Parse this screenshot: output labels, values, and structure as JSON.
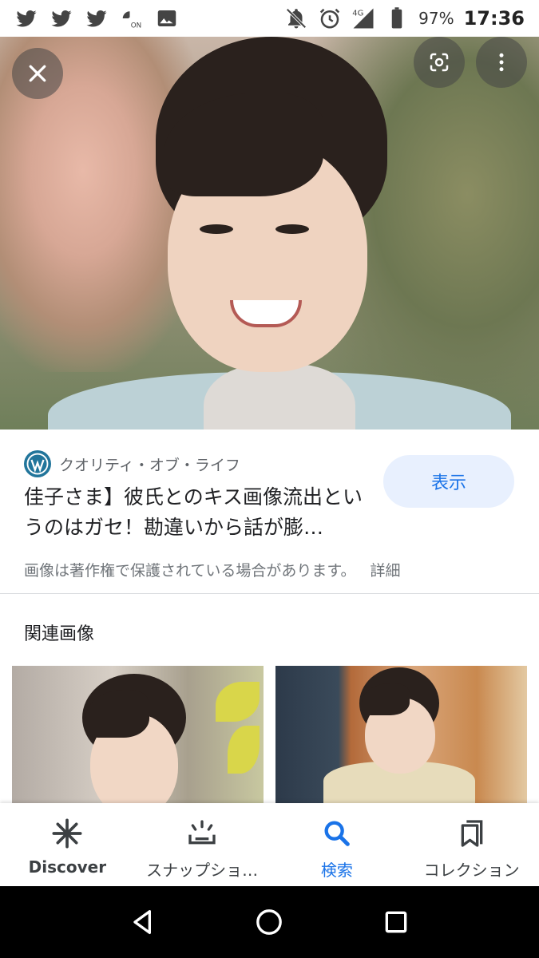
{
  "status_bar": {
    "icons": [
      "twitter-icon",
      "twitter-icon",
      "twitter-icon",
      "nfc-on-icon",
      "image-icon",
      "notifications-off-icon",
      "alarm-icon",
      "signal-4g-icon",
      "battery-icon"
    ],
    "battery_percent": "97%",
    "time": "17:36"
  },
  "hero": {
    "close_icon": "close-icon",
    "lens_icon": "lens-search-icon",
    "more_icon": "more-vert-icon"
  },
  "result": {
    "source_icon": "wordpress-icon",
    "source_name": "クオリティ・オブ・ライフ",
    "title": "佳子さま】彼氏とのキス画像流出というのはガセ！勘違いから話が膨…",
    "view_button": "表示",
    "copyright_notice": "画像は著作権で保護されている場合があります。",
    "details_link": "詳細"
  },
  "related": {
    "title": "関連画像"
  },
  "bottom_nav": {
    "items": [
      {
        "icon": "discover-asterisk-icon",
        "label": "Discover"
      },
      {
        "icon": "snapshot-icon",
        "label": "スナップショ…"
      },
      {
        "icon": "search-icon",
        "label": "検索"
      },
      {
        "icon": "collections-icon",
        "label": "コレクション"
      }
    ],
    "active_index": 2
  },
  "system_nav": {
    "back_icon": "back-triangle-icon",
    "home_icon": "home-circle-icon",
    "recents_icon": "recents-square-icon"
  },
  "colors": {
    "accent": "#1a73e8",
    "button_bg": "#e8f0fe",
    "text_primary": "#202124",
    "text_secondary": "#70757a"
  }
}
